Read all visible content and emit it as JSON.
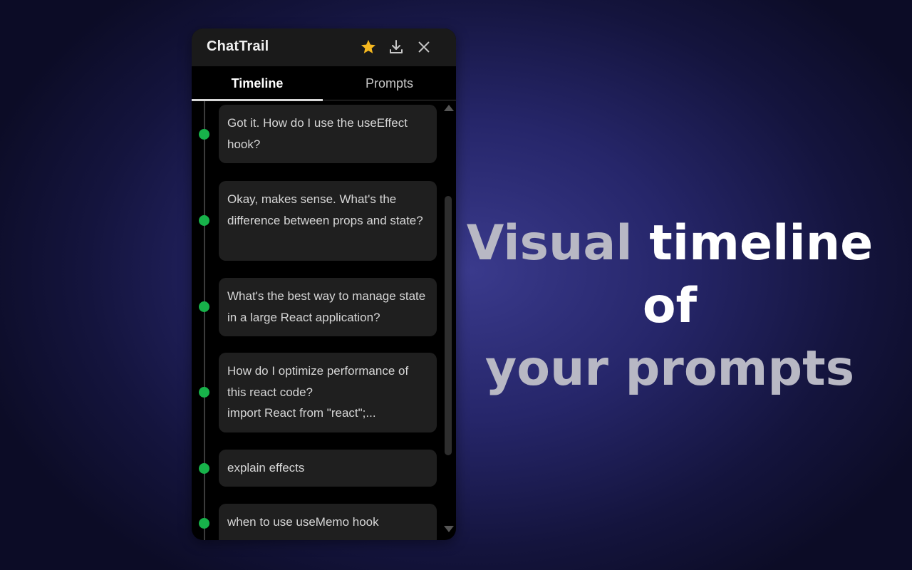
{
  "app": {
    "title": "ChatTrail",
    "header_icons": [
      "star-icon",
      "download-icon",
      "close-icon"
    ],
    "star_color": "#f5b820"
  },
  "tabs": [
    {
      "label": "Timeline",
      "active": true
    },
    {
      "label": "Prompts",
      "active": false
    }
  ],
  "timeline": {
    "items": [
      {
        "text": "Got it. How do I use the useEffect hook?"
      },
      {
        "text": "Okay, makes sense. What's the difference between props and state?"
      },
      {
        "text": "What's the best way to manage state in a large React application?"
      },
      {
        "text": "How do I optimize performance of this react code?\nimport React from \"react\";..."
      },
      {
        "text": "explain effects"
      },
      {
        "text": "when to use useMemo hook"
      }
    ],
    "dot_color": "#17b24a"
  },
  "headline": {
    "part1": "Visual",
    "part2": "timeline of",
    "part3": "your",
    "part4": "prompts"
  }
}
